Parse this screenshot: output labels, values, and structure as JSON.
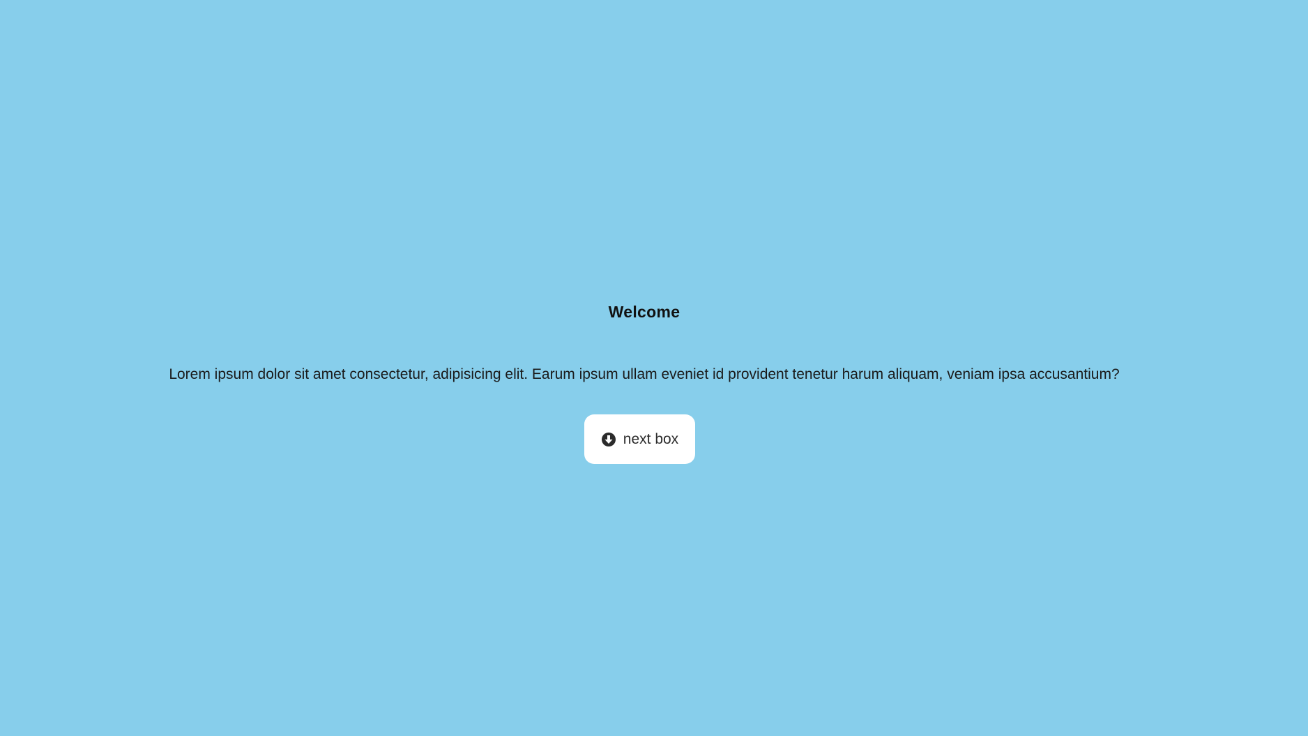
{
  "background_color": "#87CEEB",
  "box": {
    "title": "Welcome",
    "text": "Lorem ipsum dolor sit amet consectetur, adipisicing elit. Earum ipsum ullam eveniet id provident tenetur harum aliquam, veniam ipsa accusantium?",
    "button": {
      "label": "next box",
      "icon": "arrow-circle-down-icon"
    }
  }
}
